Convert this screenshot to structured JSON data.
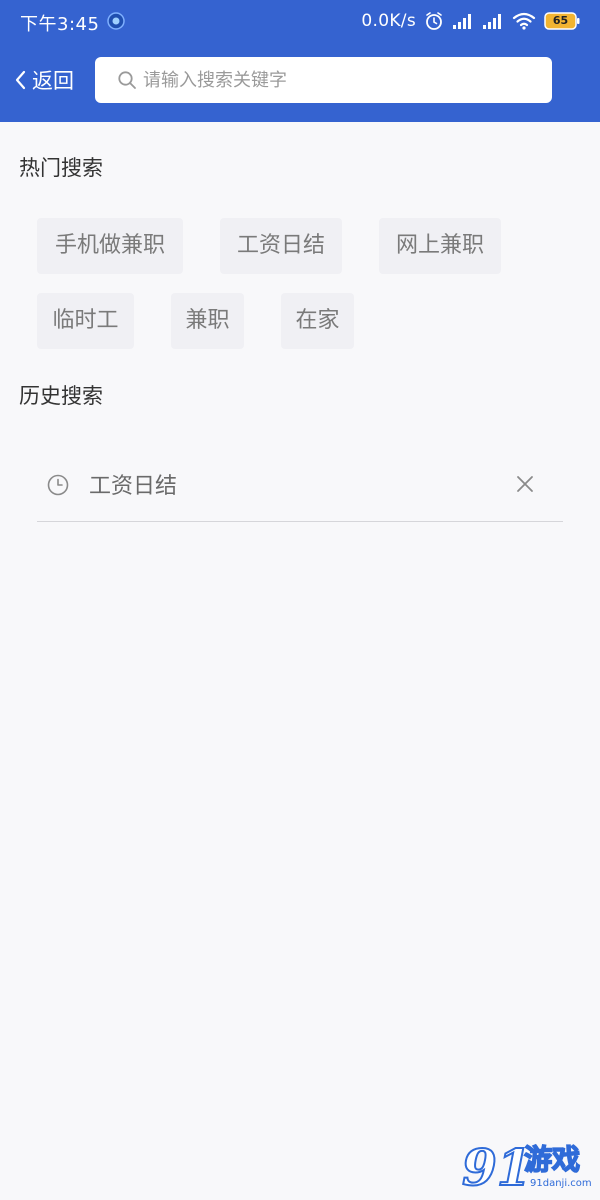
{
  "status_bar": {
    "time": "下午3:45",
    "network_speed": "0.0K/s",
    "battery_level": "65",
    "icons": [
      "app-notification-icon",
      "alarm-icon",
      "signal-icon",
      "signal-icon",
      "wifi-icon",
      "battery-icon"
    ]
  },
  "header": {
    "back_label": "返回",
    "search_placeholder": "请输入搜索关键字",
    "search_value": ""
  },
  "hot_search": {
    "title": "热门搜索",
    "tags": [
      "手机做兼职",
      "工资日结",
      "网上兼职",
      "临时工",
      "兼职",
      "在家"
    ]
  },
  "history_search": {
    "title": "历史搜索",
    "items": [
      "工资日结"
    ]
  },
  "watermark": {
    "number": "91",
    "text": "游戏",
    "url": "91danji.com"
  },
  "colors": {
    "header_bg": "#3563d0",
    "page_bg": "#f8f8fa",
    "tag_bg": "#f0f0f4",
    "battery_fill": "#f2b431"
  }
}
